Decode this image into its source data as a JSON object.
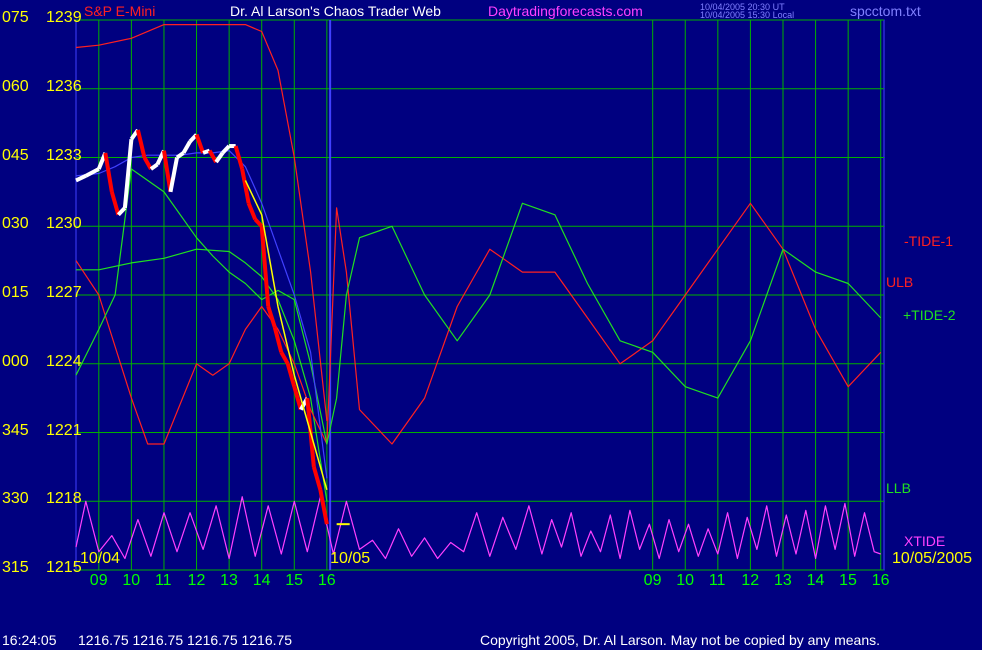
{
  "header": {
    "symbol": "S&P E-Mini",
    "title": "Dr. Al Larson's Chaos Trader Web",
    "website": "Daytradingforecasts.com",
    "timestamp_ut": "10/04/2005 20:30 UT",
    "timestamp_local": "10/04/2005 15:30 Local",
    "filename": "spcctom.txt"
  },
  "footer": {
    "time": "16:24:05",
    "quote": "1216.75 1216.75 1216.75 1216.75",
    "copyright": "Copyright 2005, Dr. Al Larson. May not be copied by any means."
  },
  "colors": {
    "background": "#000080",
    "grid": "#00b000",
    "price_up": "#ffffff",
    "price_down": "#ff0000",
    "ulb": "#ff2020",
    "llb": "#20e020",
    "tide_minus1": "#ff2020",
    "tide_plus2": "#20e020",
    "xtide": "#ff40ff",
    "blue_line": "#4040ff",
    "yellow_line": "#ffff00",
    "price_axis": "#ffff00",
    "time_axis": "#00ff00"
  },
  "chart_data": {
    "type": "line",
    "title": "S&P E-Mini",
    "ylim": [
      1215,
      1239
    ],
    "y_ticks": [
      {
        "left": "075",
        "price": "1239",
        "value": 1239
      },
      {
        "left": "060",
        "price": "1236",
        "value": 1236
      },
      {
        "left": "045",
        "price": "1233",
        "value": 1233
      },
      {
        "left": "030",
        "price": "1230",
        "value": 1230
      },
      {
        "left": "015",
        "price": "1227",
        "value": 1227
      },
      {
        "left": "000",
        "price": "1224",
        "value": 1224
      },
      {
        "left": "345",
        "price": "1221",
        "value": 1221
      },
      {
        "left": "330",
        "price": "1218",
        "value": 1218
      },
      {
        "left": "315",
        "price": "1215",
        "value": 1215
      }
    ],
    "x_ticks": [
      "09",
      "10",
      "11",
      "12",
      "13",
      "14",
      "15",
      "16",
      "09",
      "10",
      "11",
      "12",
      "13",
      "14",
      "15",
      "16"
    ],
    "x_hours": [
      9,
      10,
      11,
      12,
      13,
      14,
      15,
      16,
      26,
      27,
      28,
      29,
      30,
      31,
      32,
      33
    ],
    "xlim": [
      8.3,
      33.1
    ],
    "date_labels": [
      {
        "text": "10/04",
        "hour": 8.5
      },
      {
        "text": "10/05",
        "hour": 16.1
      },
      {
        "text": "10/05/2005",
        "hour": 33.2
      }
    ],
    "series_labels": [
      "-TIDE-1",
      "ULB",
      "+TIDE-2",
      "LLB",
      "XTIDE"
    ],
    "series": [
      {
        "name": "price",
        "x": [
          8.3,
          8.6,
          9.0,
          9.2,
          9.4,
          9.6,
          9.8,
          10.0,
          10.2,
          10.4,
          10.6,
          10.8,
          11.0,
          11.2,
          11.4,
          11.6,
          11.8,
          12.0,
          12.2,
          12.4,
          12.6,
          12.8,
          13.0,
          13.2,
          13.4,
          13.6,
          13.8,
          14.0,
          14.2,
          14.4,
          14.6,
          14.8,
          15.0,
          15.2,
          15.4,
          15.6,
          15.8,
          16.0
        ],
        "values": [
          1232.0,
          1232.2,
          1232.5,
          1233.2,
          1231.5,
          1230.5,
          1230.8,
          1233.8,
          1234.2,
          1233.0,
          1232.5,
          1232.7,
          1233.3,
          1231.5,
          1233.0,
          1233.2,
          1233.7,
          1234.0,
          1233.2,
          1233.3,
          1232.8,
          1233.2,
          1233.5,
          1233.5,
          1232.5,
          1231.0,
          1230.3,
          1230.0,
          1226.5,
          1225.6,
          1224.5,
          1224.0,
          1223.0,
          1222.0,
          1222.5,
          1219.5,
          1218.5,
          1217.0
        ]
      },
      {
        "name": "ULB",
        "x": [
          8.3,
          9,
          10,
          11,
          12,
          13,
          13.5,
          14,
          14.5,
          15,
          15.5,
          16
        ],
        "values": [
          1237.8,
          1237.9,
          1238.2,
          1238.8,
          1238.8,
          1238.8,
          1238.8,
          1238.5,
          1236.8,
          1233.0,
          1228.0,
          1221.5
        ]
      },
      {
        "name": "LLB",
        "x": [
          8.3,
          9,
          10,
          11,
          12,
          13,
          13.5,
          14,
          14.5,
          15,
          15.5,
          16
        ],
        "values": [
          1228.1,
          1228.1,
          1228.4,
          1228.6,
          1229.0,
          1228.9,
          1228.4,
          1227.8,
          1226.8,
          1225.0,
          1222.5,
          1218.0
        ]
      },
      {
        "name": "-TIDE-1",
        "x": [
          8.3,
          9,
          10,
          10.5,
          11,
          12,
          12.5,
          13,
          13.5,
          14,
          14.5,
          15,
          15.5,
          16,
          16.3,
          16.6,
          17,
          18,
          19,
          20,
          21,
          22,
          23,
          24,
          25,
          26,
          27,
          28,
          29,
          30,
          31,
          32,
          33
        ],
        "values": [
          1228.5,
          1227.0,
          1222.5,
          1220.5,
          1220.5,
          1224.0,
          1223.5,
          1224.0,
          1225.5,
          1226.5,
          1225.5,
          1224.0,
          1222.0,
          1220.5,
          1230.8,
          1228.0,
          1222.0,
          1220.5,
          1222.5,
          1226.5,
          1229.0,
          1228.0,
          1228.0,
          1226.0,
          1224.0,
          1225.0,
          1227.0,
          1229.0,
          1231.0,
          1229.0,
          1225.5,
          1223.0,
          1224.5
        ]
      },
      {
        "name": "+TIDE-2",
        "x": [
          8.3,
          9,
          9.5,
          10,
          11,
          12,
          12.5,
          13,
          13.5,
          14,
          14.5,
          15,
          15.5,
          16,
          16.3,
          16.6,
          17,
          18,
          19,
          20,
          21,
          22,
          23,
          24,
          25,
          26,
          27,
          28,
          29,
          30,
          31,
          32,
          33
        ],
        "values": [
          1223.5,
          1225.5,
          1227.0,
          1232.5,
          1231.5,
          1229.5,
          1228.7,
          1228.0,
          1227.5,
          1226.8,
          1227.2,
          1226.8,
          1224.0,
          1220.5,
          1222.5,
          1227.0,
          1229.5,
          1230.0,
          1227.0,
          1225.0,
          1227.0,
          1231.0,
          1230.5,
          1227.5,
          1225.0,
          1224.5,
          1223.0,
          1222.5,
          1225.0,
          1229.0,
          1228.0,
          1227.5,
          1226.0
        ]
      },
      {
        "name": "blue",
        "x": [
          8.3,
          9,
          9.5,
          10,
          10.5,
          11,
          11.5,
          12,
          12.5,
          13,
          13.5,
          14,
          14.5,
          15,
          15.5,
          16
        ],
        "values": [
          1232.2,
          1232.3,
          1232.6,
          1233.0,
          1233.1,
          1233.1,
          1233.1,
          1233.2,
          1233.2,
          1233.3,
          1232.6,
          1231.0,
          1229.0,
          1227.0,
          1224.5,
          1219.0
        ]
      },
      {
        "name": "yellow",
        "x": [
          13.5,
          14,
          14.5,
          15,
          15.5,
          16
        ],
        "values": [
          1232.0,
          1230.5,
          1226.5,
          1223.5,
          1221.0,
          1218.5
        ]
      },
      {
        "name": "XTIDE",
        "x": [
          8.3,
          8.6,
          9.0,
          9.4,
          9.8,
          10.2,
          10.6,
          11.0,
          11.4,
          11.8,
          12.2,
          12.6,
          13.0,
          13.4,
          13.8,
          14.2,
          14.6,
          15.0,
          15.4,
          15.8,
          16.2,
          16.6,
          17.0,
          17.4,
          17.8,
          18.2,
          18.6,
          19.0,
          19.4,
          19.8,
          20.2,
          20.6,
          21.0,
          21.4,
          21.8,
          22.2,
          22.6,
          22.9,
          23.2,
          23.5,
          23.8,
          24.1,
          24.4,
          24.7,
          25.0,
          25.3,
          25.6,
          25.9,
          26.2,
          26.5,
          26.8,
          27.1,
          27.4,
          27.7,
          28.0,
          28.3,
          28.6,
          28.9,
          29.2,
          29.5,
          29.8,
          30.1,
          30.4,
          30.7,
          31.0,
          31.3,
          31.6,
          31.9,
          32.2,
          32.5,
          32.8,
          33.0
        ],
        "values": [
          1216.0,
          1218.0,
          1215.8,
          1216.5,
          1215.5,
          1217.2,
          1215.6,
          1217.5,
          1215.8,
          1217.5,
          1215.9,
          1217.8,
          1215.5,
          1218.2,
          1215.6,
          1217.8,
          1215.7,
          1218.0,
          1215.8,
          1218.2,
          1215.7,
          1218.0,
          1215.9,
          1216.3,
          1215.5,
          1216.8,
          1215.6,
          1216.4,
          1215.5,
          1216.2,
          1215.8,
          1217.5,
          1215.6,
          1217.3,
          1215.9,
          1217.8,
          1215.7,
          1217.2,
          1216.0,
          1217.5,
          1215.6,
          1216.7,
          1215.8,
          1217.4,
          1215.5,
          1217.6,
          1215.9,
          1217.0,
          1215.5,
          1217.2,
          1215.8,
          1217.0,
          1215.6,
          1216.8,
          1215.7,
          1217.5,
          1215.5,
          1217.3,
          1215.9,
          1217.8,
          1215.6,
          1217.4,
          1215.7,
          1217.6,
          1215.5,
          1217.8,
          1215.9,
          1217.9,
          1215.6,
          1217.5,
          1215.8,
          1215.7
        ]
      }
    ],
    "grid": true
  }
}
